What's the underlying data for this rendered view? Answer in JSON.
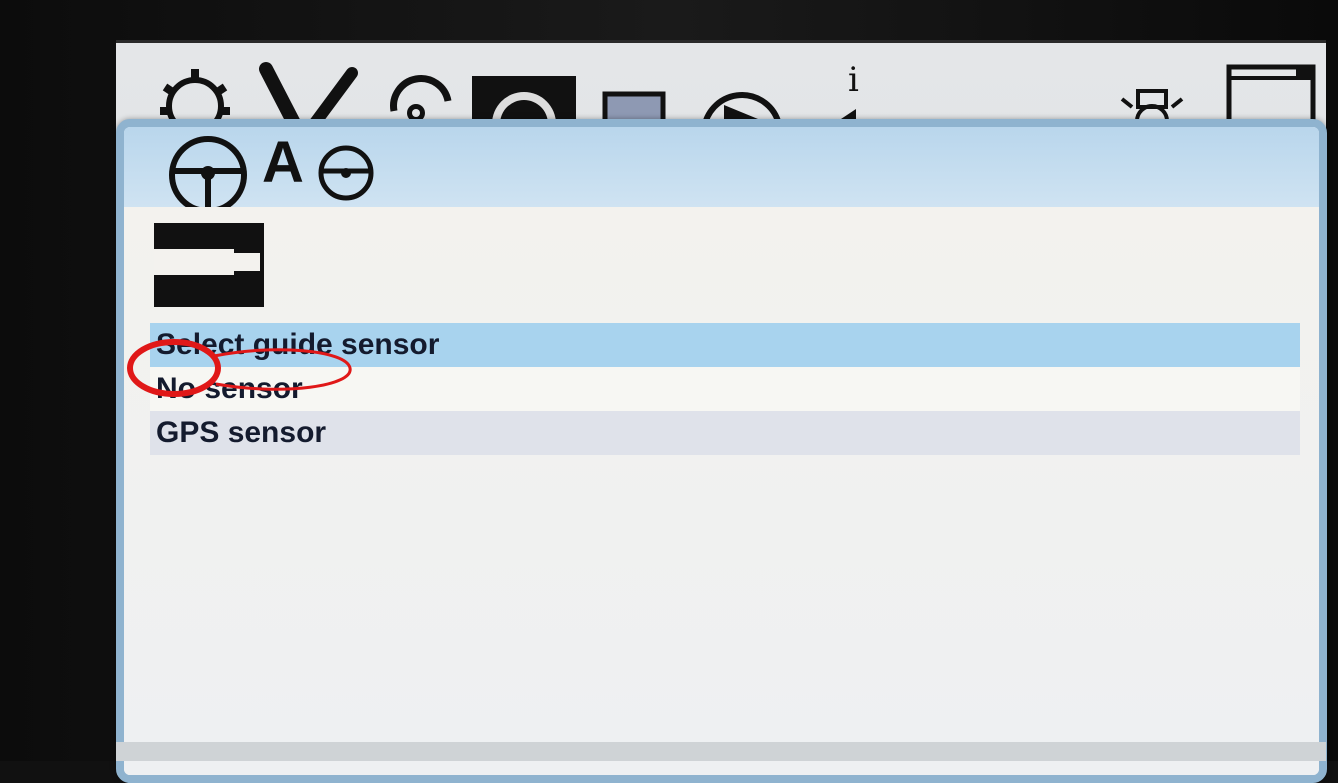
{
  "toolbar": {
    "icons": [
      "gear-icon",
      "implement-icon",
      "speed-icon",
      "steering-wheel-tab-icon",
      "display-icon",
      "play-icon",
      "info-icon",
      "light-icon",
      "window-icon"
    ]
  },
  "dialog": {
    "header_letter": "A",
    "list": {
      "title": "Select guide sensor",
      "options": [
        {
          "label": "No sensor",
          "selected": true
        },
        {
          "label": "GPS sensor",
          "selected": false
        }
      ]
    }
  },
  "colors": {
    "header_band": "#b9d6ec",
    "selected_row": "#a8d3ee",
    "annotation": "#e01818",
    "text": "#141b2e"
  }
}
